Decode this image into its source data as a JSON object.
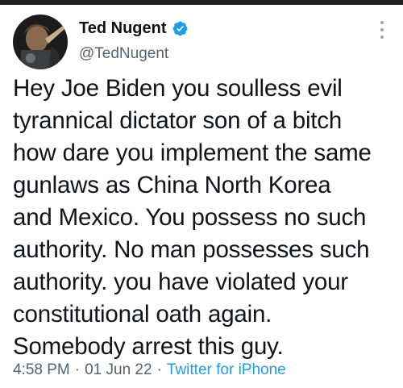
{
  "author": {
    "display_name": "Ted Nugent",
    "handle": "@TedNugent",
    "verified_icon": "verified-badge-icon",
    "avatar_icon": "avatar-image"
  },
  "tweet": {
    "text": "Hey Joe Biden you soulless evil\ntyrannical dictator son of a bitch\nhow dare you implement the same\ngunlaws as China North Korea\nand Mexico. You possess no such\nauthority. No man possesses such\nauthority. you have violated your\nconstitutional oath again.\nSomebody arrest this guy."
  },
  "meta": {
    "time": "4:58 PM",
    "separator": "·",
    "date": "01 Jun 22",
    "source": "Twitter for iPhone"
  },
  "colors": {
    "text": "#0f1419",
    "secondary": "#536471",
    "accent": "#1d9bf0"
  },
  "more_icon": "more-options-icon"
}
